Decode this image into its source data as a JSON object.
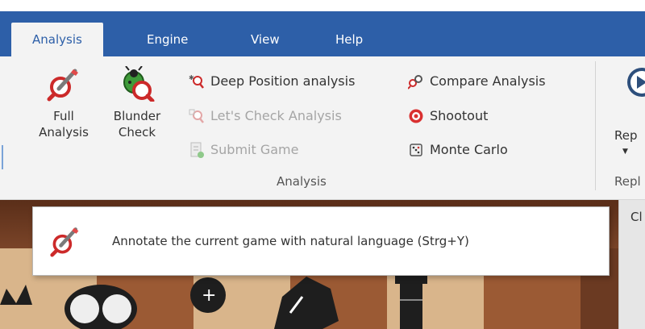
{
  "tabs": [
    {
      "label": "Analysis"
    },
    {
      "label": "Engine"
    },
    {
      "label": "View"
    },
    {
      "label": "Help"
    }
  ],
  "ribbon": {
    "full_analysis": {
      "line1": "Full",
      "line2": "Analysis",
      "icon": "magnifier-pencil-icon"
    },
    "blunder_check": {
      "line1": "Blunder",
      "line2": "Check",
      "icon": "bug-magnifier-icon"
    },
    "deep_position": "Deep Position analysis",
    "lets_check": "Let's Check Analysis",
    "submit_game": "Submit Game",
    "compare_analysis": "Compare Analysis",
    "shootout": "Shootout",
    "monte_carlo": "Monte Carlo",
    "group_label": "Analysis",
    "replay_partial": "Rep",
    "replay_group_partial": "Repl"
  },
  "side_panel_partial": "Cl",
  "tooltip": {
    "text": "Annotate the current game with natural language (Strg+Y)",
    "icon": "magnifier-pencil-icon"
  },
  "colors": {
    "accent": "#2d5fa8",
    "ribbon_bg": "#f3f3f3",
    "disabled_text": "#a5a5a5"
  }
}
